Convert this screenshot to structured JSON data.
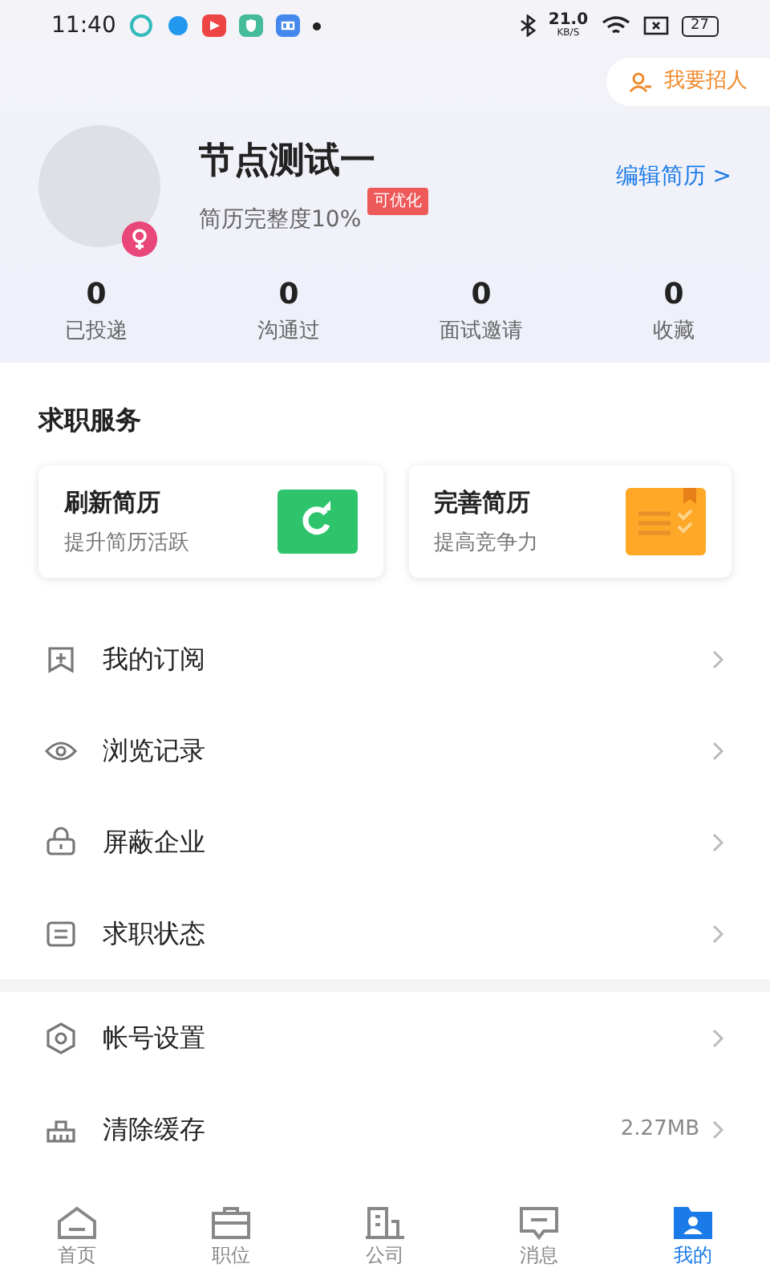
{
  "status_bar": {
    "time": "11:40",
    "speed": "21.0",
    "speed_unit": "KB/S",
    "battery": "27"
  },
  "recruit_button": {
    "label": "我要招人"
  },
  "profile": {
    "name": "节点测试一",
    "completeness": "简历完整度10%",
    "badge": "可优化",
    "edit_link": "编辑简历",
    "chevron": ">"
  },
  "stats": [
    {
      "value": "0",
      "label": "已投递"
    },
    {
      "value": "0",
      "label": "沟通过"
    },
    {
      "value": "0",
      "label": "面试邀请"
    },
    {
      "value": "0",
      "label": "收藏"
    }
  ],
  "services": {
    "title": "求职服务",
    "cards": [
      {
        "kind": "refresh",
        "title": "刷新简历",
        "subtitle": "提升简历活跃"
      },
      {
        "kind": "improve",
        "title": "完善简历",
        "subtitle": "提高竞争力"
      }
    ]
  },
  "menu_groups": [
    [
      {
        "kind": "subscribe",
        "label": "我的订阅"
      },
      {
        "kind": "history",
        "label": "浏览记录"
      },
      {
        "kind": "block",
        "label": "屏蔽企业"
      },
      {
        "kind": "status",
        "label": "求职状态"
      }
    ],
    [
      {
        "kind": "settings",
        "label": "帐号设置"
      },
      {
        "kind": "cache",
        "label": "清除缓存",
        "value": "2.27MB"
      }
    ]
  ],
  "tab_bar": [
    {
      "kind": "home",
      "label": "首页",
      "selected": false
    },
    {
      "kind": "jobs",
      "label": "职位",
      "selected": false
    },
    {
      "kind": "company",
      "label": "公司",
      "selected": false
    },
    {
      "kind": "message",
      "label": "消息",
      "selected": false
    },
    {
      "kind": "me",
      "label": "我的",
      "selected": true
    }
  ]
}
